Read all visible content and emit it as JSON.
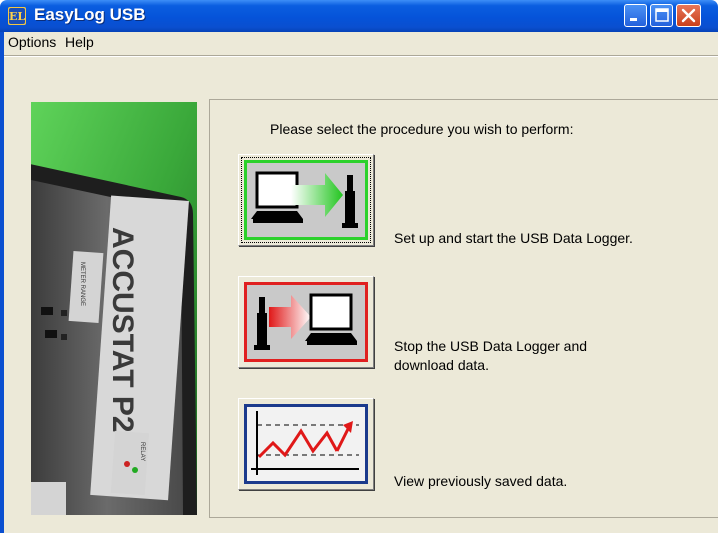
{
  "window": {
    "title": "EasyLog USB",
    "icon_name": "easylog-app-icon",
    "controls": [
      "minimize-icon",
      "maximize-icon",
      "close-icon"
    ]
  },
  "menu": {
    "options_label": "Options",
    "help_label": "Help"
  },
  "main": {
    "instruction": "Please select the procedure you wish to perform:",
    "procedures": [
      {
        "label": "Set up and start the USB Data Logger.",
        "icon": "setup-logger-icon",
        "accent": "#2bd12b"
      },
      {
        "label_line1": "Stop the USB Data Logger and",
        "label_line2": "download data.",
        "icon": "download-logger-icon",
        "accent": "#e02020"
      },
      {
        "label": "View previously saved data.",
        "icon": "graph-icon",
        "accent": "#1b3a8c"
      }
    ]
  },
  "photo": {
    "description_text": "ACCUSTAT P2",
    "small_labels": [
      "METER RANGE",
      "RELAY"
    ]
  },
  "colors": {
    "titlebar": "#0553d9",
    "window_face": "#ece9d8",
    "close_button": "#c8401c"
  }
}
